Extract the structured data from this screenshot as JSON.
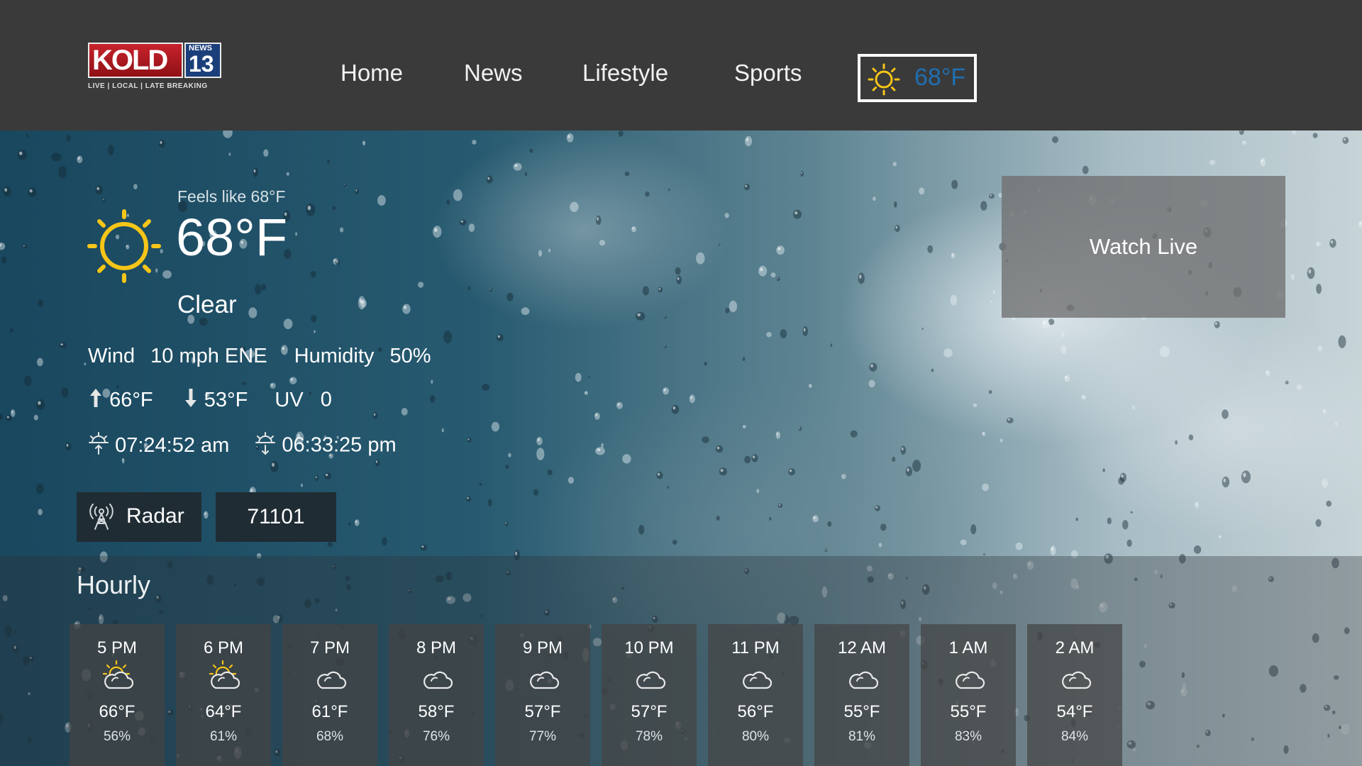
{
  "brand": {
    "name": "KOLD",
    "badge_top": "NEWS",
    "badge_num": "13",
    "tagline": "LIVE | LOCAL | LATE BREAKING"
  },
  "nav": {
    "items": [
      "Home",
      "News",
      "Lifestyle",
      "Sports"
    ],
    "weather_temp": "68°F",
    "weather_icon": "sun-icon",
    "weather_temp_color": "#1f6fb3"
  },
  "current": {
    "feels_like": "Feels like 68°F",
    "temp": "68°F",
    "condition": "Clear",
    "icon": "sun-icon",
    "wind_label": "Wind",
    "wind_value": "10 mph ENE",
    "humidity_label": "Humidity",
    "humidity_value": "50%",
    "high": "66°F",
    "low": "53°F",
    "uv_label": "UV",
    "uv_value": "0",
    "sunrise": "07:24:52 am",
    "sunset": "06:33:25 pm"
  },
  "actions": {
    "radar_label": "Radar",
    "radar_icon": "radar-tower-icon",
    "zip": "71101",
    "watch_live": "Watch Live"
  },
  "hourly": {
    "title": "Hourly",
    "items": [
      {
        "time": "5 PM",
        "icon": "partly-sunny-icon",
        "temp": "66°F",
        "humidity": "56%"
      },
      {
        "time": "6 PM",
        "icon": "partly-sunny-icon",
        "temp": "64°F",
        "humidity": "61%"
      },
      {
        "time": "7 PM",
        "icon": "cloud-icon",
        "temp": "61°F",
        "humidity": "68%"
      },
      {
        "time": "8 PM",
        "icon": "cloud-icon",
        "temp": "58°F",
        "humidity": "76%"
      },
      {
        "time": "9 PM",
        "icon": "cloud-icon",
        "temp": "57°F",
        "humidity": "77%"
      },
      {
        "time": "10 PM",
        "icon": "cloud-icon",
        "temp": "57°F",
        "humidity": "78%"
      },
      {
        "time": "11 PM",
        "icon": "cloud-icon",
        "temp": "56°F",
        "humidity": "80%"
      },
      {
        "time": "12 AM",
        "icon": "cloud-icon",
        "temp": "55°F",
        "humidity": "81%"
      },
      {
        "time": "1 AM",
        "icon": "cloud-icon",
        "temp": "55°F",
        "humidity": "83%"
      },
      {
        "time": "2 AM",
        "icon": "cloud-icon",
        "temp": "54°F",
        "humidity": "84%"
      }
    ]
  },
  "colors": {
    "sun": "#f5c518",
    "brand_red": "#c8232c",
    "card_bg": "#444444"
  }
}
